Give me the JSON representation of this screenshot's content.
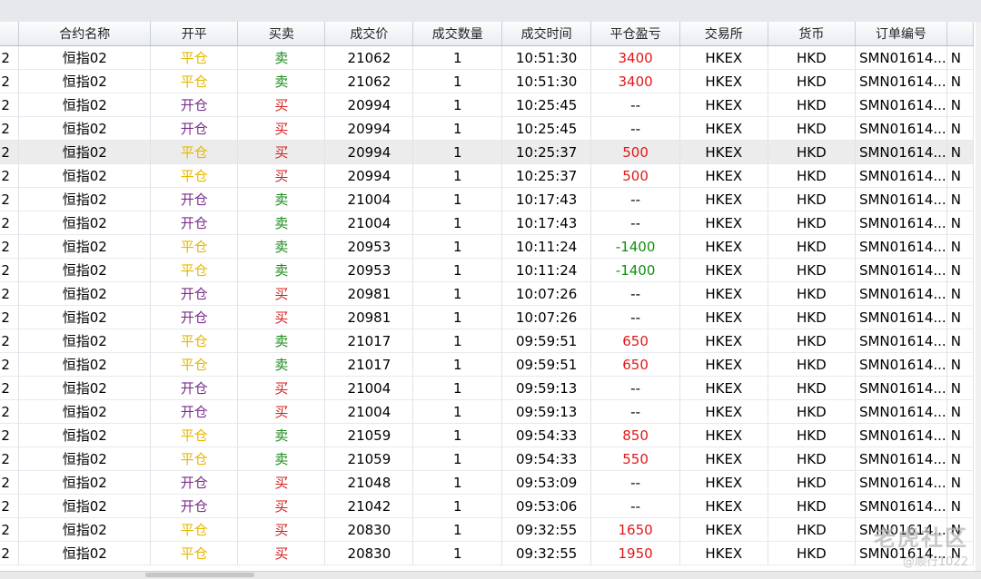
{
  "columns": [
    "",
    "合约名称",
    "开平",
    "买卖",
    "成交价",
    "成交数量",
    "成交时间",
    "平仓盈亏",
    "交易所",
    "货币",
    "订单编号",
    ""
  ],
  "rows": [
    {
      "lead": "2",
      "name": "恒指02",
      "oc": "平仓",
      "oc_type": "close",
      "bs": "卖",
      "bs_type": "sell",
      "price": "21062",
      "qty": "1",
      "time": "10:51:30",
      "pnl": "3400",
      "pnl_type": "pos",
      "exch": "HKEX",
      "cur": "HKD",
      "order": "SMN01614...",
      "trail": "N"
    },
    {
      "lead": "2",
      "name": "恒指02",
      "oc": "平仓",
      "oc_type": "close",
      "bs": "卖",
      "bs_type": "sell",
      "price": "21062",
      "qty": "1",
      "time": "10:51:30",
      "pnl": "3400",
      "pnl_type": "pos",
      "exch": "HKEX",
      "cur": "HKD",
      "order": "SMN01614...",
      "trail": "N"
    },
    {
      "lead": "2",
      "name": "恒指02",
      "oc": "开仓",
      "oc_type": "open",
      "bs": "买",
      "bs_type": "buy",
      "price": "20994",
      "qty": "1",
      "time": "10:25:45",
      "pnl": "--",
      "pnl_type": "none",
      "exch": "HKEX",
      "cur": "HKD",
      "order": "SMN01614...",
      "trail": "N"
    },
    {
      "lead": "2",
      "name": "恒指02",
      "oc": "开仓",
      "oc_type": "open",
      "bs": "买",
      "bs_type": "buy",
      "price": "20994",
      "qty": "1",
      "time": "10:25:45",
      "pnl": "--",
      "pnl_type": "none",
      "exch": "HKEX",
      "cur": "HKD",
      "order": "SMN01614...",
      "trail": "N"
    },
    {
      "lead": "2",
      "name": "恒指02",
      "oc": "平仓",
      "oc_type": "close",
      "bs": "买",
      "bs_type": "buy",
      "price": "20994",
      "qty": "1",
      "time": "10:25:37",
      "pnl": "500",
      "pnl_type": "pos",
      "exch": "HKEX",
      "cur": "HKD",
      "order": "SMN01614...",
      "trail": "N",
      "selected": true
    },
    {
      "lead": "2",
      "name": "恒指02",
      "oc": "平仓",
      "oc_type": "close",
      "bs": "买",
      "bs_type": "buy",
      "price": "20994",
      "qty": "1",
      "time": "10:25:37",
      "pnl": "500",
      "pnl_type": "pos",
      "exch": "HKEX",
      "cur": "HKD",
      "order": "SMN01614...",
      "trail": "N"
    },
    {
      "lead": "2",
      "name": "恒指02",
      "oc": "开仓",
      "oc_type": "open",
      "bs": "卖",
      "bs_type": "sell",
      "price": "21004",
      "qty": "1",
      "time": "10:17:43",
      "pnl": "--",
      "pnl_type": "none",
      "exch": "HKEX",
      "cur": "HKD",
      "order": "SMN01614...",
      "trail": "N"
    },
    {
      "lead": "2",
      "name": "恒指02",
      "oc": "开仓",
      "oc_type": "open",
      "bs": "卖",
      "bs_type": "sell",
      "price": "21004",
      "qty": "1",
      "time": "10:17:43",
      "pnl": "--",
      "pnl_type": "none",
      "exch": "HKEX",
      "cur": "HKD",
      "order": "SMN01614...",
      "trail": "N"
    },
    {
      "lead": "2",
      "name": "恒指02",
      "oc": "平仓",
      "oc_type": "close",
      "bs": "卖",
      "bs_type": "sell",
      "price": "20953",
      "qty": "1",
      "time": "10:11:24",
      "pnl": "-1400",
      "pnl_type": "neg",
      "exch": "HKEX",
      "cur": "HKD",
      "order": "SMN01614...",
      "trail": "N"
    },
    {
      "lead": "2",
      "name": "恒指02",
      "oc": "平仓",
      "oc_type": "close",
      "bs": "卖",
      "bs_type": "sell",
      "price": "20953",
      "qty": "1",
      "time": "10:11:24",
      "pnl": "-1400",
      "pnl_type": "neg",
      "exch": "HKEX",
      "cur": "HKD",
      "order": "SMN01614...",
      "trail": "N"
    },
    {
      "lead": "2",
      "name": "恒指02",
      "oc": "开仓",
      "oc_type": "open",
      "bs": "买",
      "bs_type": "buy",
      "price": "20981",
      "qty": "1",
      "time": "10:07:26",
      "pnl": "--",
      "pnl_type": "none",
      "exch": "HKEX",
      "cur": "HKD",
      "order": "SMN01614...",
      "trail": "N"
    },
    {
      "lead": "2",
      "name": "恒指02",
      "oc": "开仓",
      "oc_type": "open",
      "bs": "买",
      "bs_type": "buy",
      "price": "20981",
      "qty": "1",
      "time": "10:07:26",
      "pnl": "--",
      "pnl_type": "none",
      "exch": "HKEX",
      "cur": "HKD",
      "order": "SMN01614...",
      "trail": "N"
    },
    {
      "lead": "2",
      "name": "恒指02",
      "oc": "平仓",
      "oc_type": "close",
      "bs": "卖",
      "bs_type": "sell",
      "price": "21017",
      "qty": "1",
      "time": "09:59:51",
      "pnl": "650",
      "pnl_type": "pos",
      "exch": "HKEX",
      "cur": "HKD",
      "order": "SMN01614...",
      "trail": "N"
    },
    {
      "lead": "2",
      "name": "恒指02",
      "oc": "平仓",
      "oc_type": "close",
      "bs": "卖",
      "bs_type": "sell",
      "price": "21017",
      "qty": "1",
      "time": "09:59:51",
      "pnl": "650",
      "pnl_type": "pos",
      "exch": "HKEX",
      "cur": "HKD",
      "order": "SMN01614...",
      "trail": "N"
    },
    {
      "lead": "2",
      "name": "恒指02",
      "oc": "开仓",
      "oc_type": "open",
      "bs": "买",
      "bs_type": "buy",
      "price": "21004",
      "qty": "1",
      "time": "09:59:13",
      "pnl": "--",
      "pnl_type": "none",
      "exch": "HKEX",
      "cur": "HKD",
      "order": "SMN01614...",
      "trail": "N"
    },
    {
      "lead": "2",
      "name": "恒指02",
      "oc": "开仓",
      "oc_type": "open",
      "bs": "买",
      "bs_type": "buy",
      "price": "21004",
      "qty": "1",
      "time": "09:59:13",
      "pnl": "--",
      "pnl_type": "none",
      "exch": "HKEX",
      "cur": "HKD",
      "order": "SMN01614...",
      "trail": "N"
    },
    {
      "lead": "2",
      "name": "恒指02",
      "oc": "平仓",
      "oc_type": "close",
      "bs": "卖",
      "bs_type": "sell",
      "price": "21059",
      "qty": "1",
      "time": "09:54:33",
      "pnl": "850",
      "pnl_type": "pos",
      "exch": "HKEX",
      "cur": "HKD",
      "order": "SMN01614...",
      "trail": "N"
    },
    {
      "lead": "2",
      "name": "恒指02",
      "oc": "平仓",
      "oc_type": "close",
      "bs": "卖",
      "bs_type": "sell",
      "price": "21059",
      "qty": "1",
      "time": "09:54:33",
      "pnl": "550",
      "pnl_type": "pos",
      "exch": "HKEX",
      "cur": "HKD",
      "order": "SMN01614...",
      "trail": "N"
    },
    {
      "lead": "2",
      "name": "恒指02",
      "oc": "开仓",
      "oc_type": "open",
      "bs": "买",
      "bs_type": "buy",
      "price": "21048",
      "qty": "1",
      "time": "09:53:09",
      "pnl": "--",
      "pnl_type": "none",
      "exch": "HKEX",
      "cur": "HKD",
      "order": "SMN01614...",
      "trail": "N"
    },
    {
      "lead": "2",
      "name": "恒指02",
      "oc": "开仓",
      "oc_type": "open",
      "bs": "买",
      "bs_type": "buy",
      "price": "21042",
      "qty": "1",
      "time": "09:53:06",
      "pnl": "--",
      "pnl_type": "none",
      "exch": "HKEX",
      "cur": "HKD",
      "order": "SMN01614...",
      "trail": "N"
    },
    {
      "lead": "2",
      "name": "恒指02",
      "oc": "平仓",
      "oc_type": "close",
      "bs": "买",
      "bs_type": "buy",
      "price": "20830",
      "qty": "1",
      "time": "09:32:55",
      "pnl": "1650",
      "pnl_type": "pos",
      "exch": "HKEX",
      "cur": "HKD",
      "order": "SMN01614...",
      "trail": "N"
    },
    {
      "lead": "2",
      "name": "恒指02",
      "oc": "平仓",
      "oc_type": "close",
      "bs": "买",
      "bs_type": "buy",
      "price": "20830",
      "qty": "1",
      "time": "09:32:55",
      "pnl": "1950",
      "pnl_type": "pos",
      "exch": "HKEX",
      "cur": "HKD",
      "order": "SMN01614...",
      "trail": "N"
    }
  ],
  "watermark": {
    "line1": "老虎社区",
    "line2": "@顺行1022"
  },
  "colors": {
    "open": "#7a2f8e",
    "close": "#e6b800",
    "buy": "#d21e1e",
    "sell": "#1a8a1a",
    "profit": "#e01818",
    "loss": "#109010"
  }
}
